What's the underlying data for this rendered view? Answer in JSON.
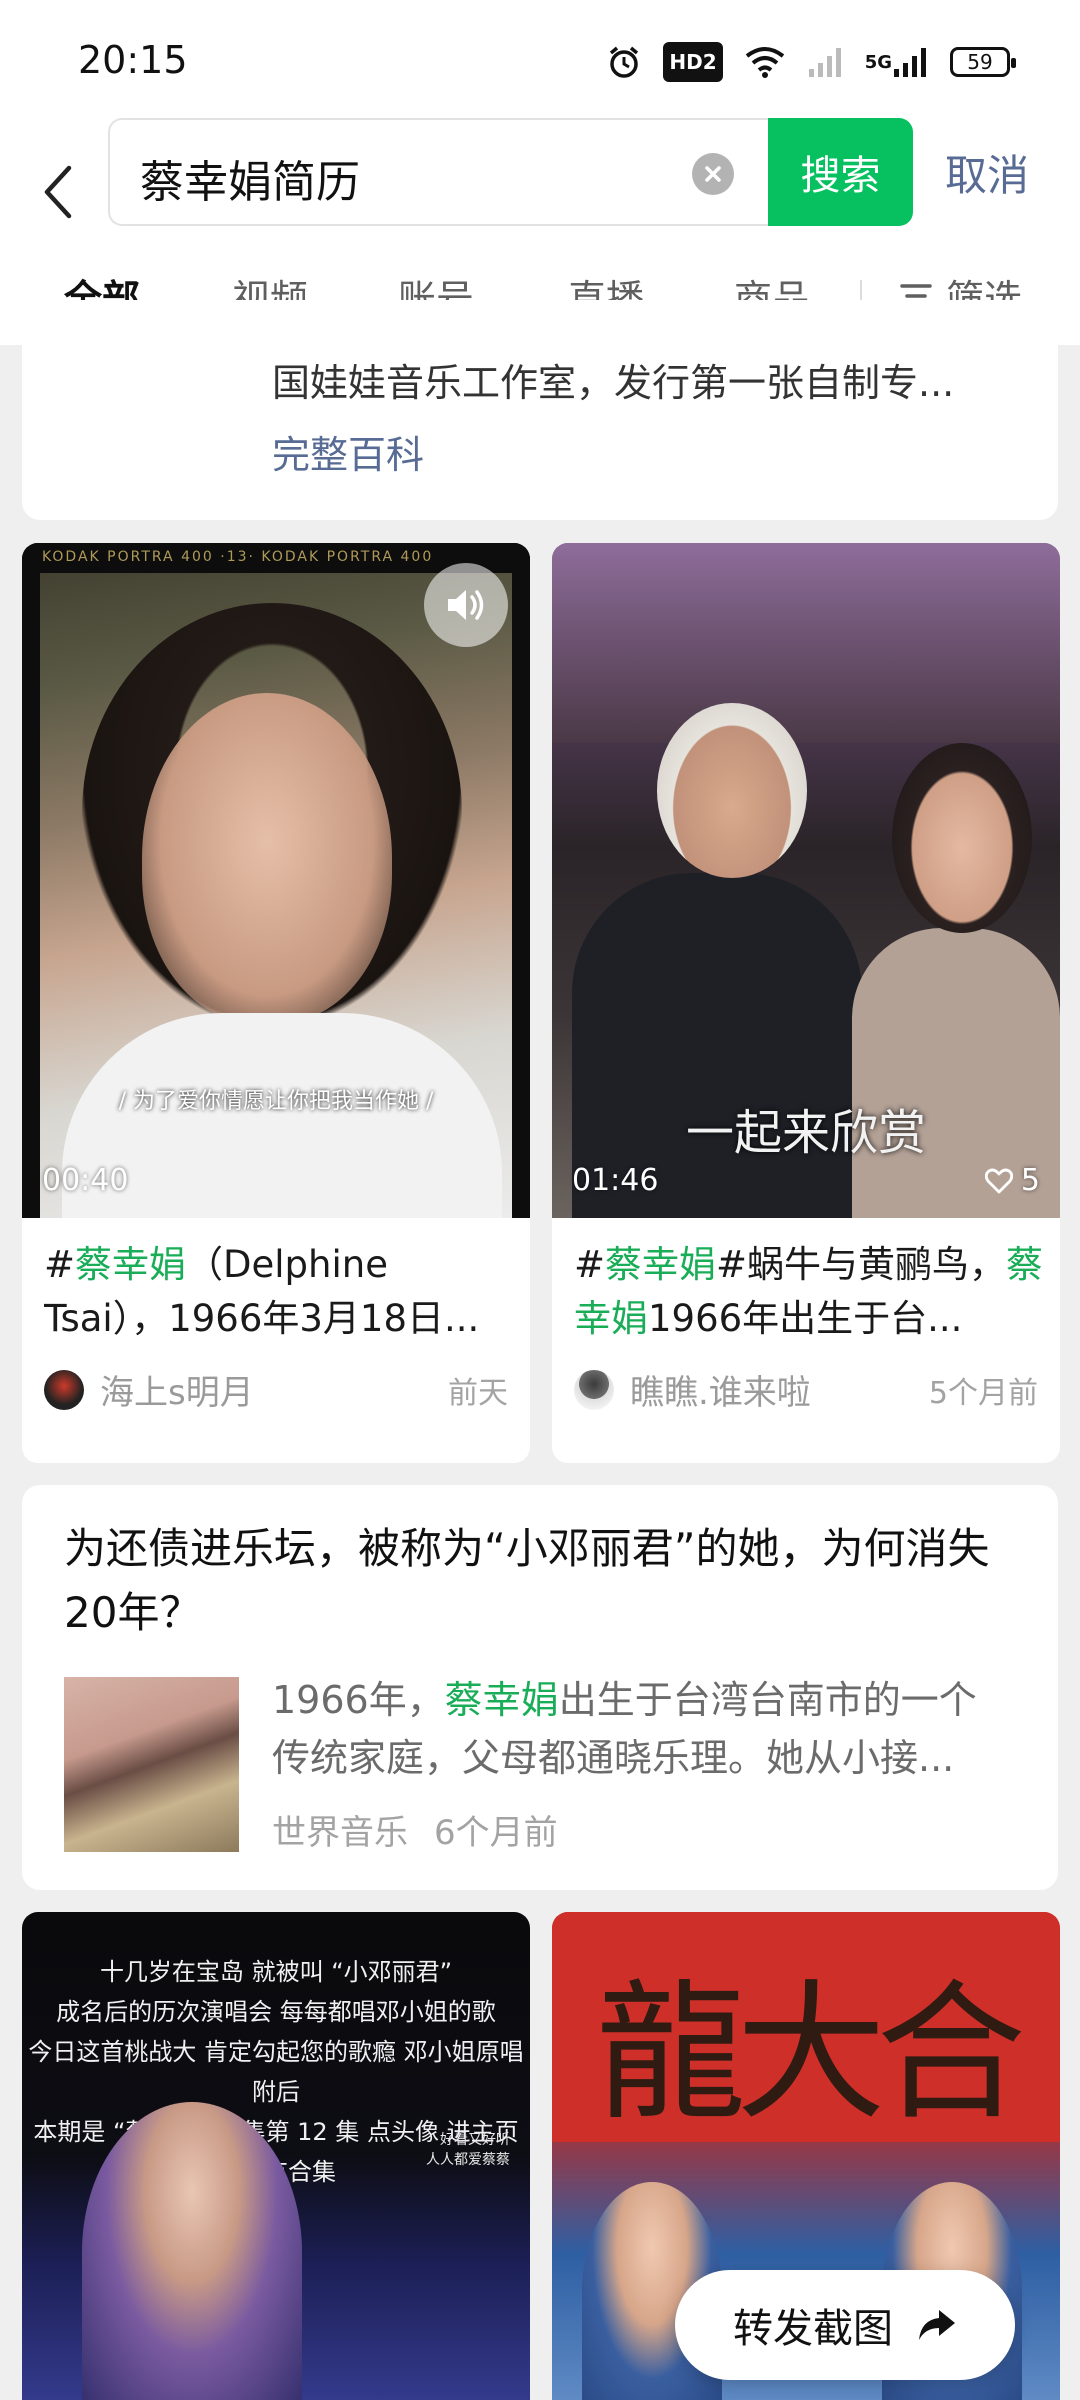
{
  "status_bar": {
    "time": "20:15",
    "hd": "HD2",
    "net": "5G",
    "battery": "59",
    "icons": [
      "alarm-icon",
      "hd-icon",
      "wifi-icon",
      "signal-icon",
      "signal-5g-icon",
      "battery-icon"
    ]
  },
  "search": {
    "query": "蔡幸娟简历",
    "search_button": "搜索",
    "cancel": "取消"
  },
  "tabs": {
    "items": [
      "全部",
      "视频",
      "账号",
      "直播",
      "商品"
    ],
    "active": "全部",
    "filter": "筛选"
  },
  "baike": {
    "line_cut": "",
    "line": "国娃娃音乐工作室，发行第一张自制专...",
    "link": "完整百科"
  },
  "videos": [
    {
      "duration": "00:40",
      "subtitle": "/ 为了爱你情愿让你把我当作她 /",
      "film_text": "KODAK PORTRA 400   ·13·   KODAK PORTRA 400",
      "title_prefix": "#",
      "title_highlight": "蔡幸娟",
      "title_rest": "（Delphine Tsai），1966年3月18日...",
      "author": "海上s明月",
      "time": "前天"
    },
    {
      "duration": "01:46",
      "likes": "5",
      "subtitle": "一起来欣赏",
      "title_prefix": "#",
      "title_highlight": "蔡幸娟",
      "title_rest": "#蜗牛与黄鹂鸟，",
      "title_highlight2": "蔡幸娟",
      "title_rest2": "1966年出生于台...",
      "author": "瞧瞧.谁来啦",
      "time": "5个月前"
    }
  ],
  "article": {
    "title": "为还债进乐坛，被称为“小邓丽君”的她，为何消失20年？",
    "summary_prefix": "1966年，",
    "summary_highlight": "蔡幸娟",
    "summary_rest": "出生于台湾台南市的一个传统家庭，父母都通晓乐理。她从小接...",
    "source": "世界音乐",
    "time": "6个月前"
  },
  "bottom_videos": [
    {
      "caption_lines": [
        "十几岁在宝岛 就被叫 “小邓丽君”",
        "成名后的历次演唱会 每每都唱邓小姐的歌",
        "今日这首桃战大 肯定勾起您的歌瘾 邓小姐原唱附后",
        "本期是 “蔡幸娟” 合集第 12 集 点头像 进主页看所有合集"
      ],
      "caption_small": [
        "好看又好听",
        "人人都爱蔡蔡"
      ]
    },
    {
      "banner_text": "龍大合"
    }
  ],
  "share_float": {
    "label": "转发截图"
  },
  "colors": {
    "accent_green": "#07c160",
    "highlight_green": "#1aad58",
    "link_blue": "#576b95"
  }
}
